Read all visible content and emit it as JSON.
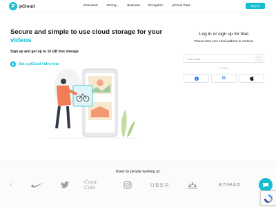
{
  "header": {
    "logo_text": "pCloud",
    "nav": {
      "download": "Download",
      "pricing": "Pricing",
      "business": "Business",
      "encryption": "Encryption",
      "pass": "pCloud Pass"
    },
    "signin_label": "Sign in"
  },
  "hero": {
    "title_main": "Secure and simple to use cloud storage for your",
    "title_highlight": "videos",
    "subtitle": "Sign up and get up to 10 GB free storage",
    "video_link": "Get a pCloud video tour"
  },
  "login": {
    "title": "Log in or sign up for free",
    "subtitle": "Please enter your email address to continue",
    "email_placeholder": "Your email",
    "or_label": "or with"
  },
  "clients": {
    "heading": "Used by people working at:",
    "brands": {
      "coca_cola": "Coca-Cola",
      "uber": "UBER",
      "etihad": "ETIHAD"
    }
  },
  "colors": {
    "accent": "#17bed0",
    "text": "#17171a",
    "illustration_orange": "#f07d55"
  },
  "icons": [
    "chevron-down-icon",
    "play-icon",
    "arrow-right-icon",
    "facebook-icon",
    "google-icon",
    "apple-icon",
    "chevron-left-icon",
    "nike-icon",
    "twitter-icon",
    "instagram-icon",
    "adidas-icon",
    "chat-icon",
    "recaptcha-icon"
  ]
}
